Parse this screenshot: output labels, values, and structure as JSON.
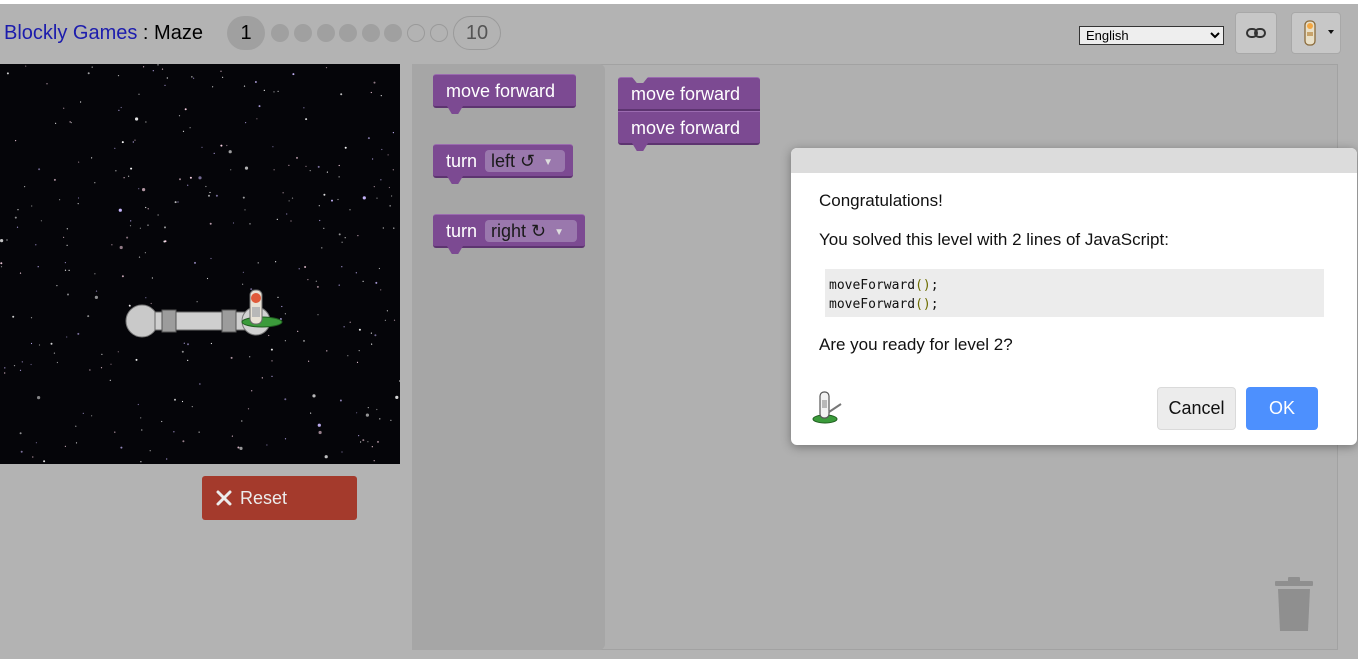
{
  "header": {
    "app_name": "Blockly Games",
    "separator": " : ",
    "game_name": "Maze",
    "current_level": "1",
    "last_level": "10",
    "language": "English",
    "language_options": [
      "English"
    ]
  },
  "maze": {
    "reset_label": "Reset"
  },
  "toolbox": {
    "move_forward": "move forward",
    "turn_left_word": "turn",
    "turn_left_option": "left ↺",
    "turn_right_word": "turn",
    "turn_right_option": "right ↻"
  },
  "workspace": {
    "blocks": [
      "move forward",
      "move forward"
    ]
  },
  "dialog": {
    "congrats": "Congratulations!",
    "solved_text": "You solved this level with 2 lines of JavaScript:",
    "code_lines": [
      "moveForward",
      "moveForward"
    ],
    "code_parens": "()",
    "code_semi": ";",
    "ready_text": "Are you ready for level 2?",
    "cancel_label": "Cancel",
    "ok_label": "OK"
  },
  "icons": {
    "link": "link-icon",
    "pegman": "pegman-icon",
    "reset": "close-icon",
    "trash": "trash-icon"
  },
  "colors": {
    "reset_button": "#a43a2c",
    "block_purple": "#7c4a92",
    "ok_button": "#4d90fe",
    "link_blue": "#1c1cad"
  }
}
